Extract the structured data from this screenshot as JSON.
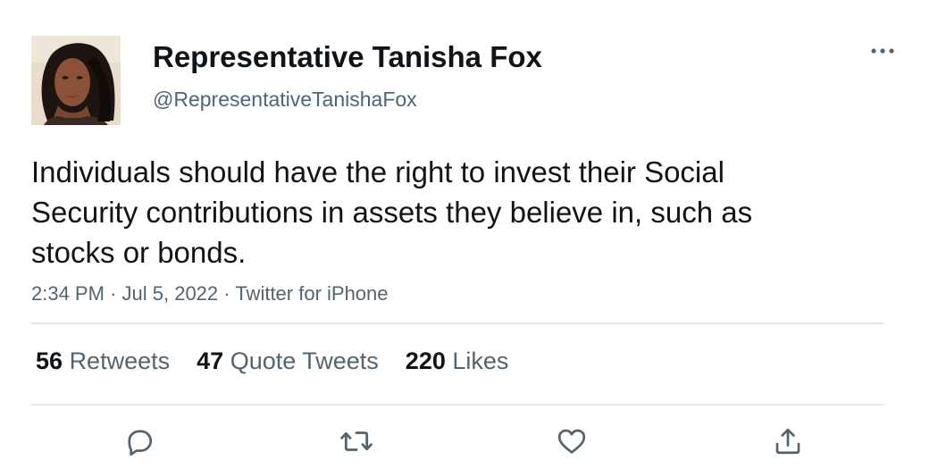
{
  "author": {
    "display_name": "Representative Tanisha Fox",
    "handle": "@RepresentativeTanishaFox",
    "avatar_icon": "profile-photo"
  },
  "tweet": {
    "text": "Individuals should have the right to invest their Social Security contributions in assets they believe in, such as stocks or bonds.",
    "time": "2:34 PM",
    "date": "Jul 5, 2022",
    "source": "Twitter for iPhone",
    "separator": "·"
  },
  "stats": {
    "retweets": {
      "count": "56",
      "label": "Retweets"
    },
    "quote_tweets": {
      "count": "47",
      "label": "Quote Tweets"
    },
    "likes": {
      "count": "220",
      "label": "Likes"
    }
  },
  "actions": [
    "reply-icon",
    "retweet-icon",
    "like-icon",
    "share-icon"
  ],
  "colors": {
    "text_primary": "#0f1419",
    "text_secondary": "#536471",
    "divider": "#e1e6ea",
    "icon": "#536471"
  }
}
